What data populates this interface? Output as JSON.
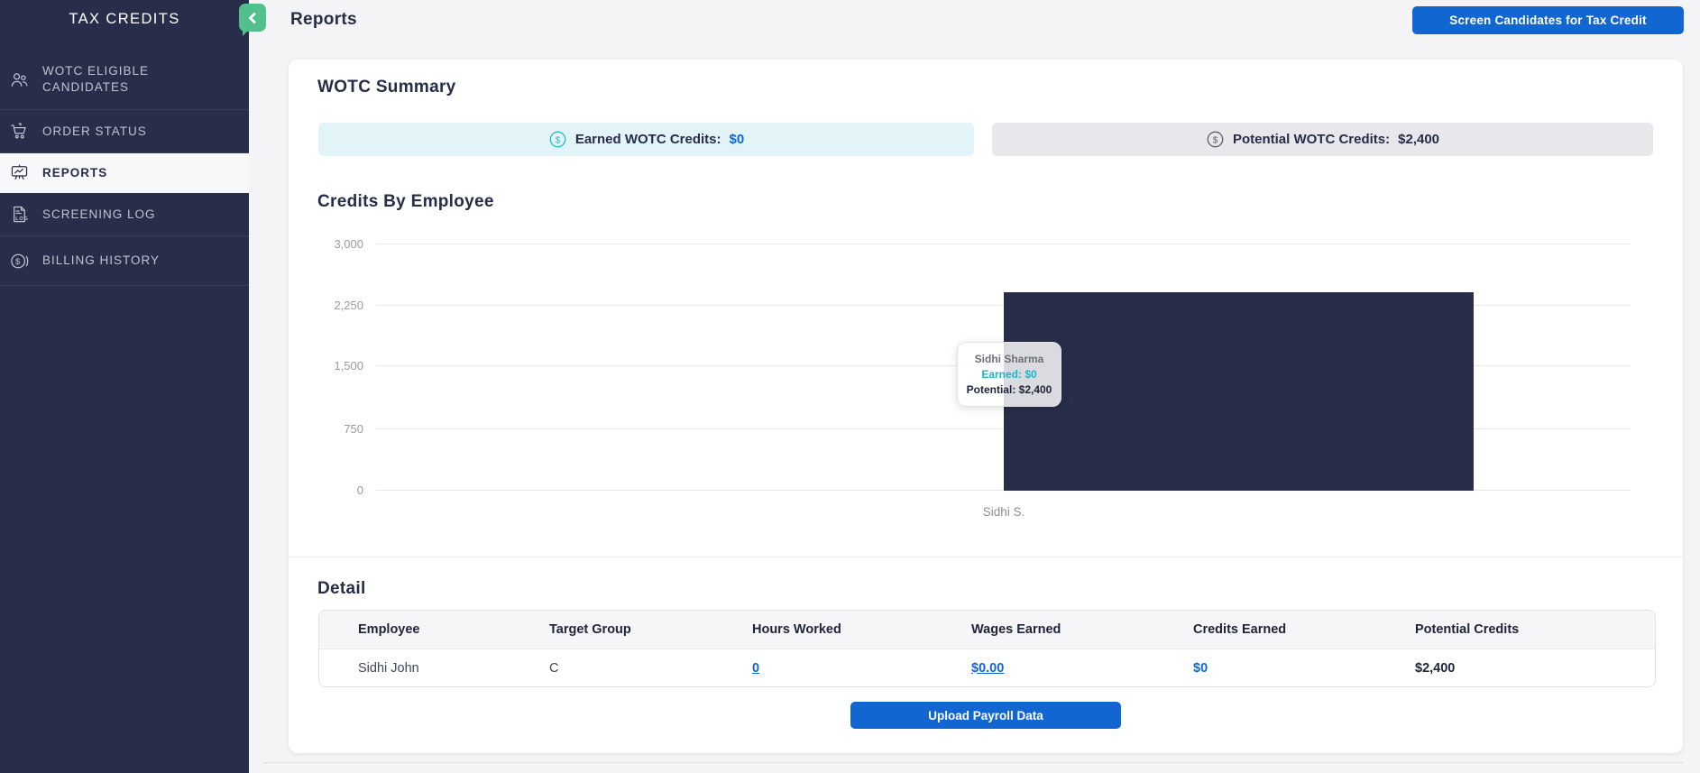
{
  "sidebar": {
    "title": "TAX CREDITS",
    "items": [
      {
        "label": "WOTC ELIGIBLE CANDIDATES",
        "icon": "users-icon",
        "active": false
      },
      {
        "label": "ORDER STATUS",
        "icon": "cart-icon",
        "active": false
      },
      {
        "label": "REPORTS",
        "icon": "chart-board-icon",
        "active": true
      },
      {
        "label": "SCREENING LOG",
        "icon": "log-document-icon",
        "active": false
      },
      {
        "label": "BILLING HISTORY",
        "icon": "dollar-coin-icon",
        "active": false
      }
    ]
  },
  "header": {
    "title": "Reports",
    "screen_candidates_button": "Screen Candidates for Tax Credit"
  },
  "summary": {
    "heading": "WOTC Summary",
    "earned_label": "Earned WOTC Credits:",
    "earned_value": "$0",
    "potential_label": "Potential WOTC Credits:",
    "potential_value": "$2,400"
  },
  "chart": {
    "heading": "Credits By Employee",
    "yticks": [
      "3,000",
      "2,250",
      "1,500",
      "750",
      "0"
    ],
    "x_label": "Sidhi S."
  },
  "chart_data": {
    "type": "bar",
    "title": "Credits By Employee",
    "categories": [
      "Sidhi S."
    ],
    "series": [
      {
        "name": "Earned",
        "values": [
          0
        ]
      },
      {
        "name": "Potential",
        "values": [
          2400
        ]
      }
    ],
    "ylim": [
      0,
      3000
    ],
    "yticks": [
      0,
      750,
      1500,
      2250,
      3000
    ],
    "grid": true,
    "bar_color": "#282d49",
    "legend_position": "none"
  },
  "tooltip": {
    "name": "Sidhi Sharma",
    "earned": "Earned: $0",
    "potential": "Potential: $2,400"
  },
  "detail": {
    "heading": "Detail",
    "columns": [
      "Employee",
      "Target Group",
      "Hours Worked",
      "Wages Earned",
      "Credits Earned",
      "Potential Credits"
    ],
    "row": {
      "employee": "Sidhi John",
      "target_group": "C",
      "hours_worked": "0",
      "wages_earned": "$0.00",
      "credits_earned": "$0",
      "potential_credits": "$2,400"
    },
    "upload_button": "Upload Payroll Data"
  },
  "colors": {
    "accent_blue": "#1266d1",
    "sidebar_navy": "#282d49",
    "collapse_green": "#50c08c",
    "earned_teal": "#2cb9c8",
    "earned_pill_bg": "#e2f4f8",
    "potential_pill_bg": "#e8e8ec"
  }
}
